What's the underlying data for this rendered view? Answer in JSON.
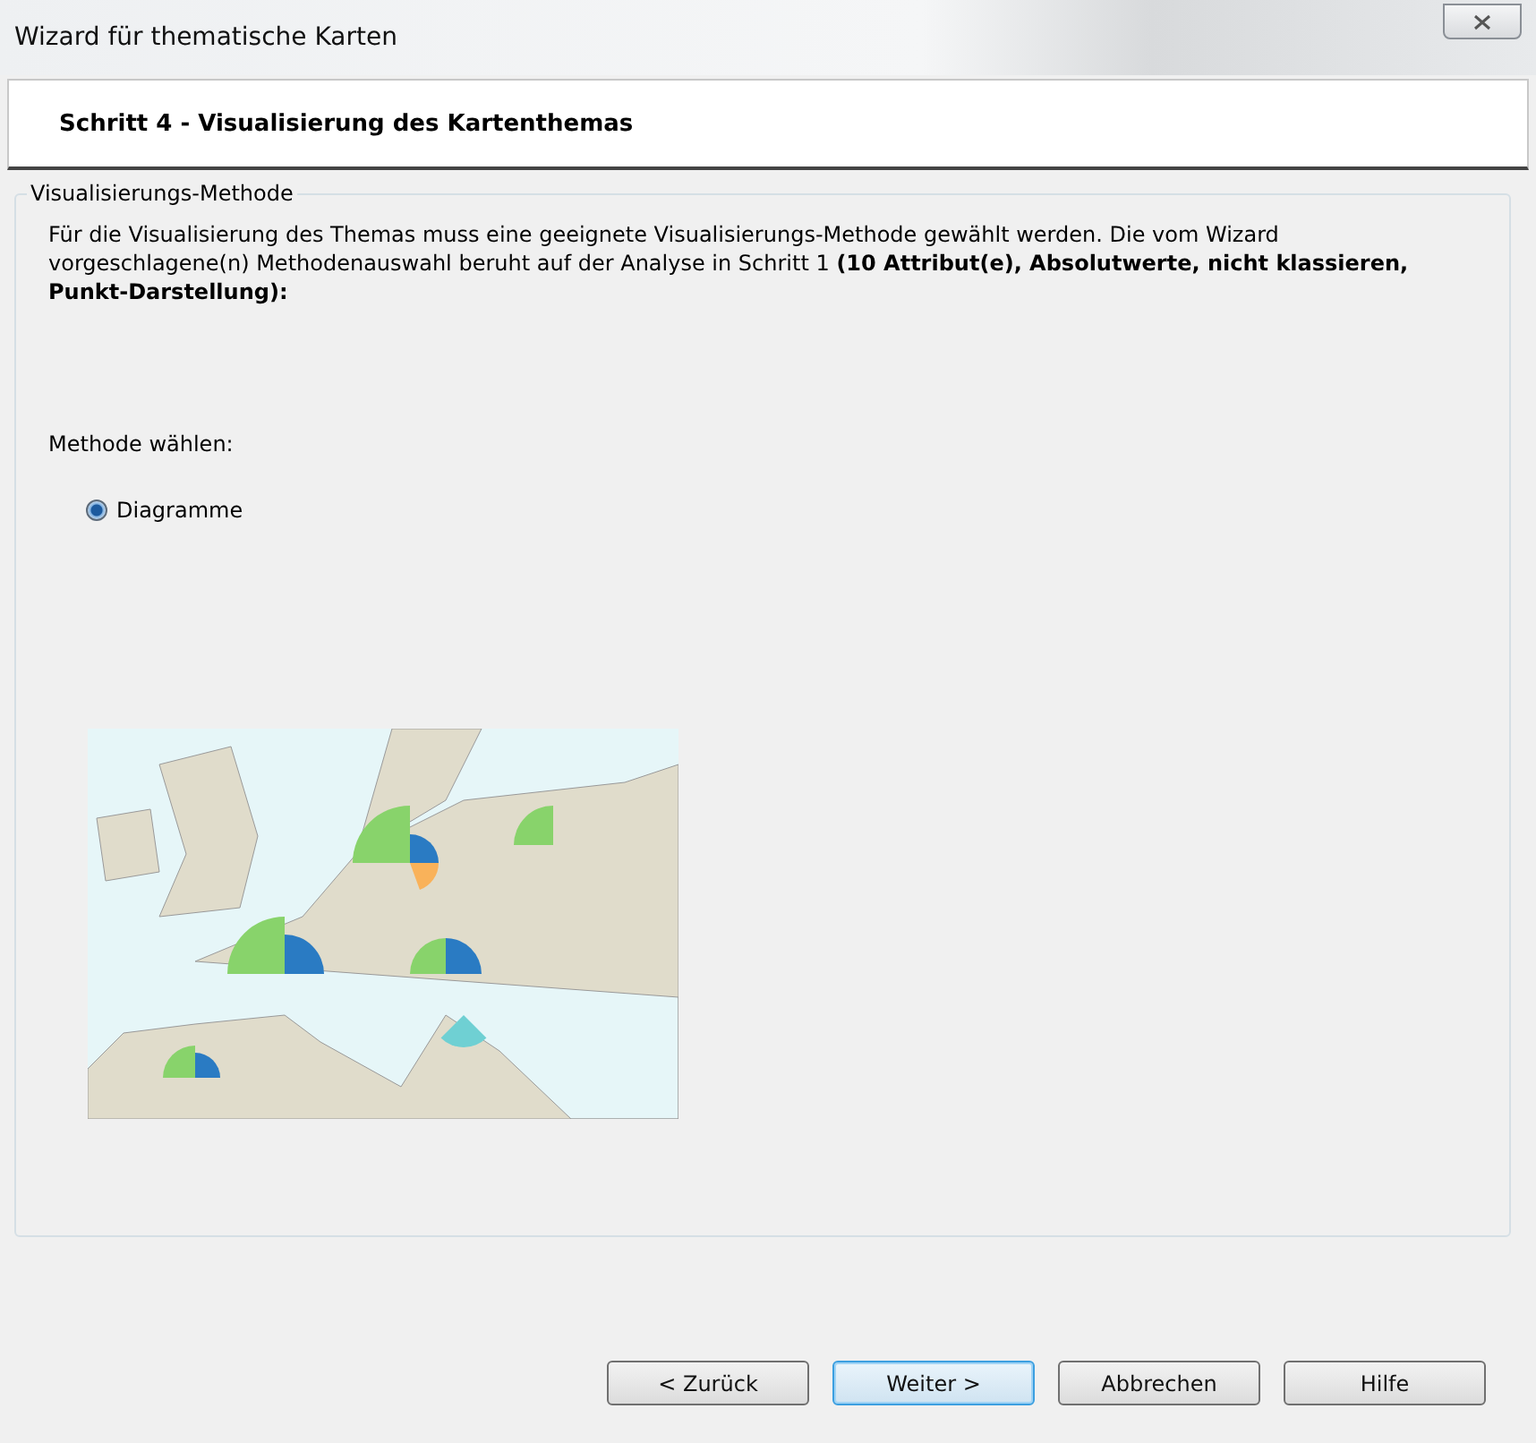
{
  "window": {
    "title": "Wizard für thematische Karten"
  },
  "header": {
    "title": "Schritt 4 - Visualisierung des Kartenthemas"
  },
  "group": {
    "legend": "Visualisierungs-Methode",
    "description": "Für die Visualisierung des Themas muss eine geeignete Visualisierungs-Methode gewählt werden. Die vom Wizard vorgeschlagene(n) Methodenauswahl beruht auf der Analyse in Schritt 1 **(10 Attribut(e), Absolutwerte, nicht klassieren, Punkt-Darstellung):**",
    "method_label": "Methode wählen:",
    "methods": [
      {
        "label": "Diagramme",
        "selected": true
      }
    ]
  },
  "buttons": [
    {
      "label": "< Zurück",
      "focused": false
    },
    {
      "label": "Weiter >",
      "focused": true
    },
    {
      "label": "Abbrechen",
      "focused": false
    },
    {
      "label": "Hilfe",
      "focused": false
    }
  ]
}
